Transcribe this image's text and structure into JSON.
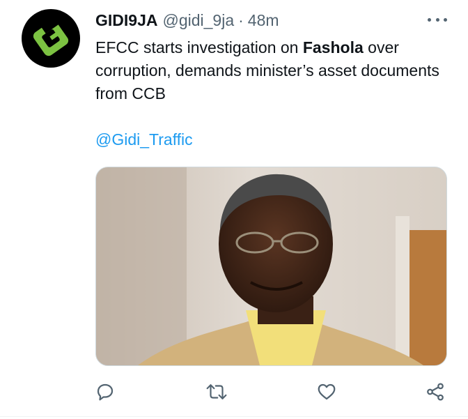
{
  "tweet": {
    "author_name": "GIDI9JA",
    "author_handle": "@gidi_9ja",
    "separator": "·",
    "time": "48m",
    "text_before": "EFCC starts investigation on ",
    "text_bold": "Fashola",
    "text_after": " over corruption, demands minister’s asset documents from CCB",
    "mention": "@Gidi_Traffic"
  },
  "icons": {
    "more": "more-horizontal-icon",
    "reply": "reply-icon",
    "retweet": "retweet-icon",
    "like": "heart-icon",
    "share": "share-icon"
  },
  "colors": {
    "link": "#1d9bf0",
    "muted": "#536471",
    "avatar_bg": "#000000",
    "logo_green": "#7cc242"
  }
}
